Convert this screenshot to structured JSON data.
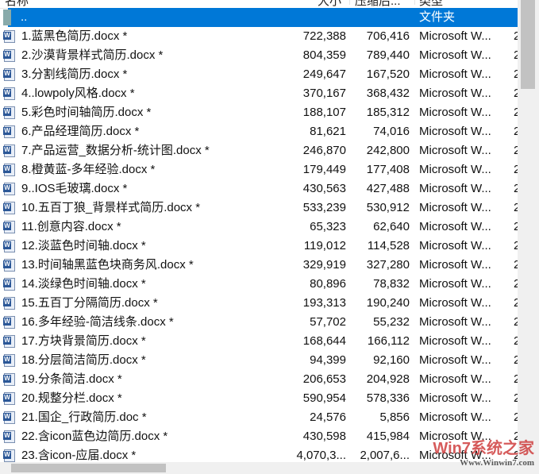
{
  "header": {
    "name": "名称",
    "size": "大小",
    "packed": "压缩后...",
    "type": "类型"
  },
  "parent": {
    "name": "..",
    "type": "文件夹"
  },
  "files": [
    {
      "name": "1.蓝黑色简历.docx *",
      "size": "722,388",
      "packed": "706,416",
      "type": "Microsoft W..."
    },
    {
      "name": "2.沙漠背景样式简历.docx *",
      "size": "804,359",
      "packed": "789,440",
      "type": "Microsoft W..."
    },
    {
      "name": "3.分割线简历.docx *",
      "size": "249,647",
      "packed": "167,520",
      "type": "Microsoft W..."
    },
    {
      "name": "4..lowpoly风格.docx *",
      "size": "370,167",
      "packed": "368,432",
      "type": "Microsoft W..."
    },
    {
      "name": "5.彩色时间轴简历.docx *",
      "size": "188,107",
      "packed": "185,312",
      "type": "Microsoft W..."
    },
    {
      "name": "6.产品经理简历.docx *",
      "size": "81,621",
      "packed": "74,016",
      "type": "Microsoft W..."
    },
    {
      "name": "7.产品运营_数据分析-统计图.docx *",
      "size": "246,870",
      "packed": "242,800",
      "type": "Microsoft W..."
    },
    {
      "name": "8.橙黄蓝-多年经验.docx *",
      "size": "179,449",
      "packed": "177,408",
      "type": "Microsoft W..."
    },
    {
      "name": "9..IOS毛玻璃.docx *",
      "size": "430,563",
      "packed": "427,488",
      "type": "Microsoft W..."
    },
    {
      "name": "10.五百丁狼_背景样式简历.docx *",
      "size": "533,239",
      "packed": "530,912",
      "type": "Microsoft W..."
    },
    {
      "name": "11.创意内容.docx *",
      "size": "65,323",
      "packed": "62,640",
      "type": "Microsoft W..."
    },
    {
      "name": "12.淡蓝色时间轴.docx *",
      "size": "119,012",
      "packed": "114,528",
      "type": "Microsoft W..."
    },
    {
      "name": "13.时间轴黑蓝色块商务风.docx *",
      "size": "329,919",
      "packed": "327,280",
      "type": "Microsoft W..."
    },
    {
      "name": "14.淡绿色时间轴.docx *",
      "size": "80,896",
      "packed": "78,832",
      "type": "Microsoft W..."
    },
    {
      "name": "15.五百丁分隔简历.docx *",
      "size": "193,313",
      "packed": "190,240",
      "type": "Microsoft W..."
    },
    {
      "name": "16.多年经验-简洁线条.docx *",
      "size": "57,702",
      "packed": "55,232",
      "type": "Microsoft W..."
    },
    {
      "name": "17.方块背景简历.docx *",
      "size": "168,644",
      "packed": "166,112",
      "type": "Microsoft W..."
    },
    {
      "name": "18.分层简洁简历.docx *",
      "size": "94,399",
      "packed": "92,160",
      "type": "Microsoft W..."
    },
    {
      "name": "19.分条简洁.docx *",
      "size": "206,653",
      "packed": "204,928",
      "type": "Microsoft W..."
    },
    {
      "name": "20.规整分栏.docx *",
      "size": "590,954",
      "packed": "578,336",
      "type": "Microsoft W..."
    },
    {
      "name": "21.国企_行政简历.doc *",
      "size": "24,576",
      "packed": "5,856",
      "type": "Microsoft W..."
    },
    {
      "name": "22.含icon蓝色边简历.docx *",
      "size": "430,598",
      "packed": "415,984",
      "type": "Microsoft W..."
    },
    {
      "name": "23.含icon-应届.docx *",
      "size": "4,070,3...",
      "packed": "2,007,6...",
      "type": "Microsoft W..."
    }
  ],
  "watermark": {
    "text": "Win7系统之家",
    "url": "Www.Winwin7.com"
  }
}
